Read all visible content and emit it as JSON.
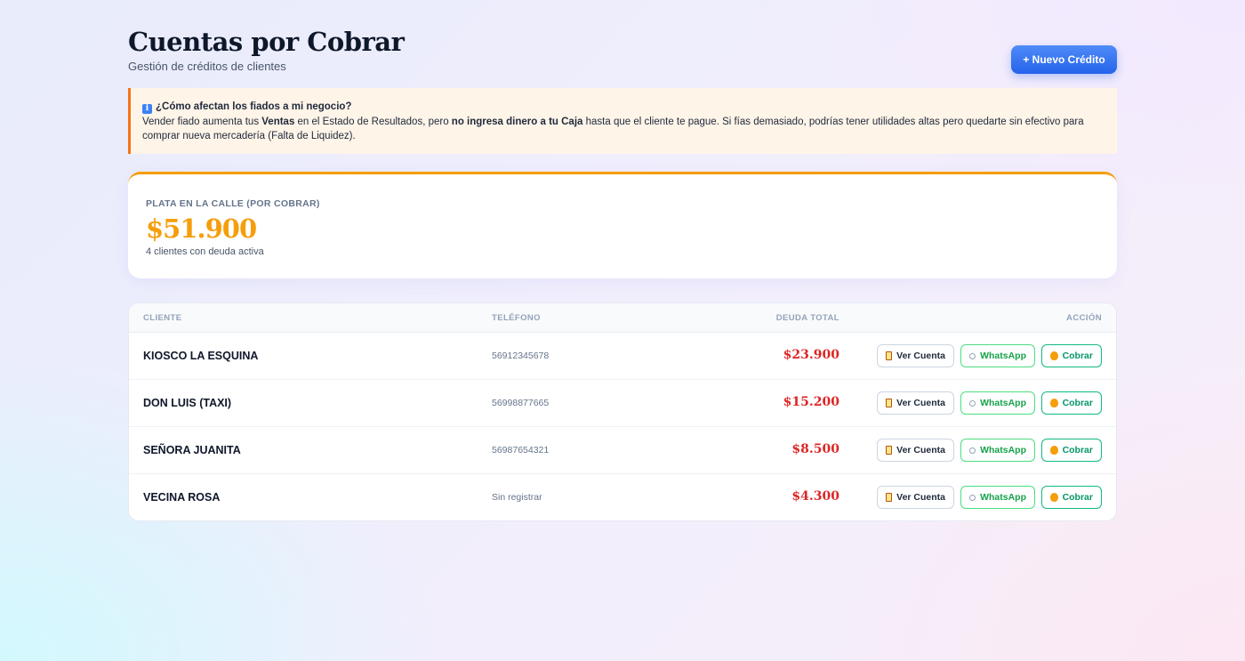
{
  "header": {
    "title": "Cuentas por Cobrar",
    "subtitle": "Gestión de créditos de clientes",
    "new_credit_label": "+ Nuevo Crédito"
  },
  "info": {
    "icon": "info-icon",
    "icon_glyph": "i",
    "title": "¿Cómo afectan los fiados a mi negocio?",
    "text_1": "Vender fiado aumenta tus ",
    "bold_1": "Ventas",
    "text_2": " en el Estado de Resultados, pero ",
    "bold_2": "no ingresa dinero a tu Caja",
    "text_3": " hasta que el cliente te pague. Si fías demasiado, podrías tener utilidades altas pero quedarte sin efectivo para comprar nueva mercadería (Falta de Liquidez)."
  },
  "summary": {
    "label": "PLATA EN LA CALLE (POR COBRAR)",
    "amount": "$51.900",
    "subtext": "4 clientes con deuda activa",
    "accent_color": "#f59e0b"
  },
  "table": {
    "columns": {
      "cliente": "CLIENTE",
      "telefono": "TELÉFONO",
      "deuda": "DEUDA TOTAL",
      "accion": "ACCIÓN"
    },
    "action_labels": {
      "ver": "Ver Cuenta",
      "whatsapp": "WhatsApp",
      "cobrar": "Cobrar"
    },
    "rows": [
      {
        "cliente": "KIOSCO LA ESQUINA",
        "telefono": "56912345678",
        "deuda": "$23.900"
      },
      {
        "cliente": "DON LUIS (TAXI)",
        "telefono": "56998877665",
        "deuda": "$15.200"
      },
      {
        "cliente": "SEÑORA JUANITA",
        "telefono": "56987654321",
        "deuda": "$8.500"
      },
      {
        "cliente": "VECINA ROSA",
        "telefono": "Sin registrar",
        "deuda": "$4.300"
      }
    ]
  },
  "colors": {
    "primary": "#2563eb",
    "debt": "#dc2626",
    "whatsapp": "#16a34a",
    "cobrar": "#059669",
    "warning_border": "#f97316"
  }
}
